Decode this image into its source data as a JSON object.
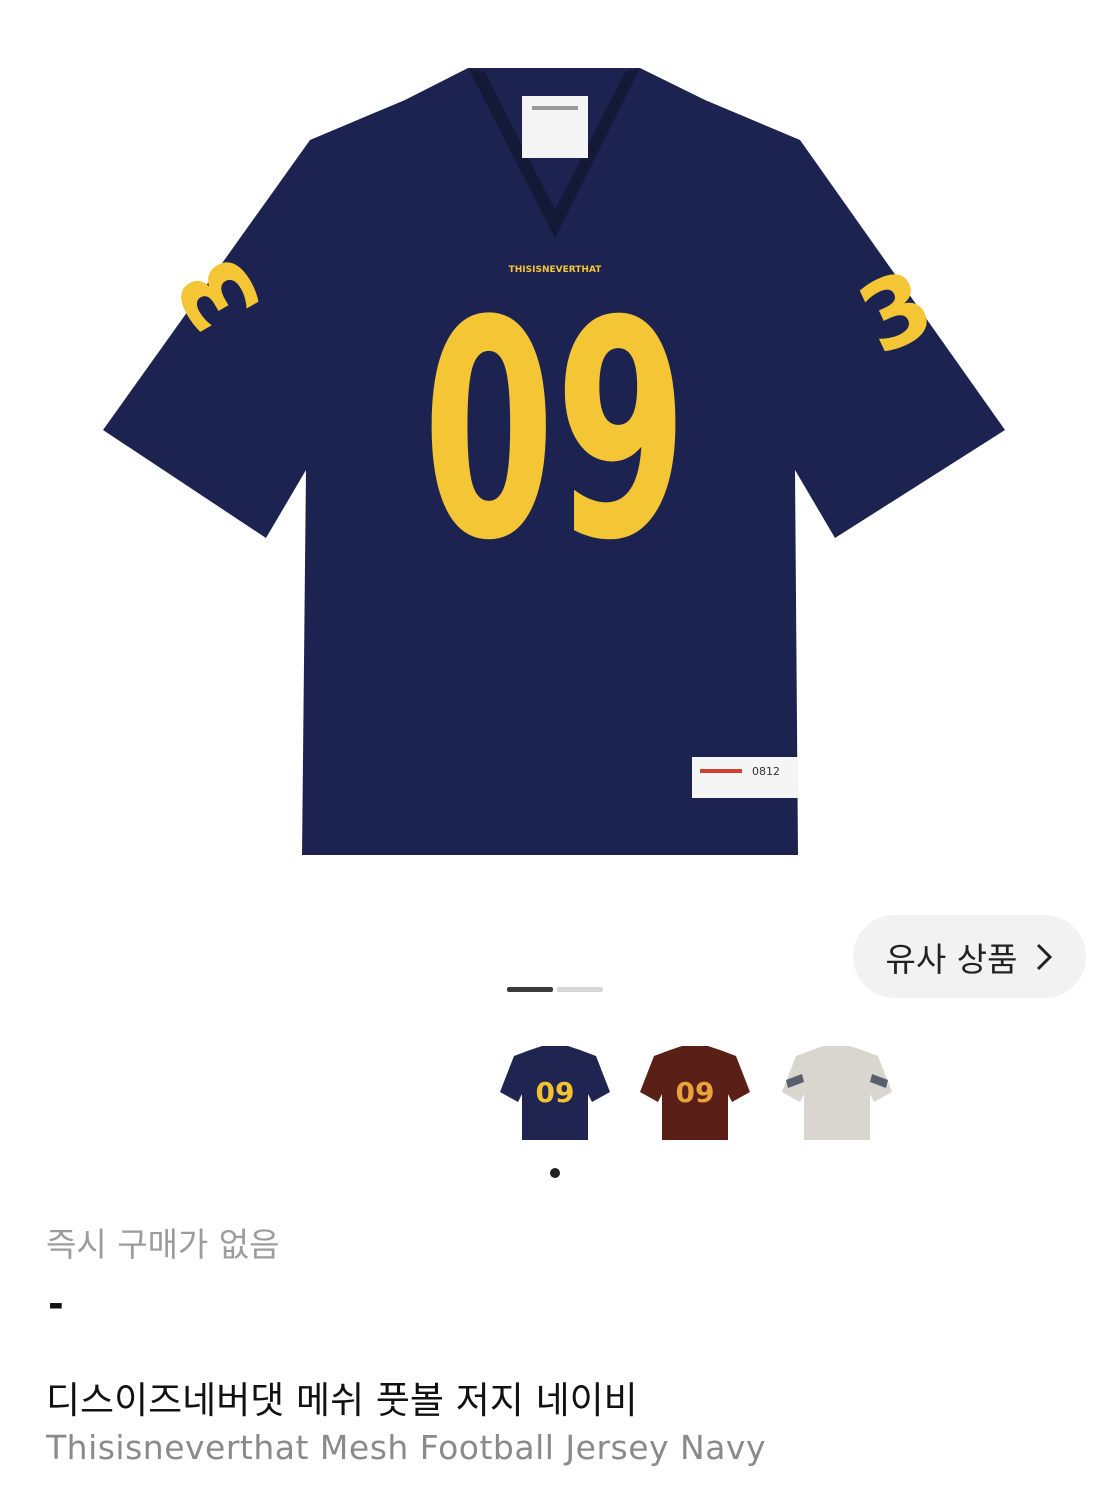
{
  "product": {
    "hero_alt": "Navy football jersey",
    "jersey_number": "09",
    "sleeve_number": "3",
    "brand_print": "THISISNEVERTHAT",
    "tag_code": "0812",
    "availability": "즉시 구매가 없음",
    "price": "-",
    "name_ko": "디스이즈네버댓 메쉬 풋볼 저지 네이비",
    "name_en": "Thisisneverthat Mesh Football Jersey Navy"
  },
  "similar": {
    "label": "유사 상품"
  },
  "gallery": {
    "active_index": 0,
    "count": 2
  },
  "variants": [
    {
      "color": "#1f2550",
      "number": "09",
      "number_color": "#f2c230"
    },
    {
      "color": "#5a1f16",
      "number": "09",
      "number_color": "#e8a33a"
    },
    {
      "color": "#d8d6cf",
      "number": "",
      "number_color": "#d8d6cf"
    }
  ],
  "colors": {
    "navy": "#1d2350",
    "yellow": "#f4c535",
    "text": "#111111",
    "muted": "#9c9c9c"
  }
}
